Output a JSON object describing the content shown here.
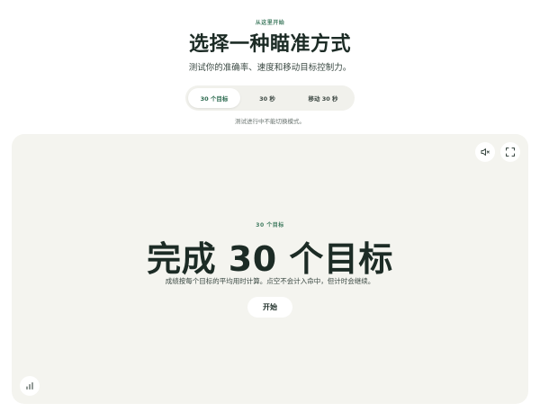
{
  "header": {
    "kicker": "从这里开始",
    "title": "选择一种瞄准方式",
    "subtitle": "测试你的准确率、速度和移动目标控制力。"
  },
  "mode_tabs": {
    "items": [
      {
        "label": "30 个目标",
        "selected": true
      },
      {
        "label": "30 秒",
        "selected": false
      },
      {
        "label": "移动 30 秒",
        "selected": false
      }
    ],
    "note": "测试进行中不能切换模式。"
  },
  "stage": {
    "kicker": "30 个目标",
    "title": "完成 30 个目标",
    "description": "成绩按每个目标的平均用时计算。点空不会计入命中，但计时会继续。",
    "start_label": "开始",
    "icons": {
      "sound": "speaker-muted-icon",
      "fullscreen": "fullscreen-icon",
      "stats": "bar-chart-icon"
    }
  },
  "colors": {
    "accent": "#3f7a5f",
    "title": "#1c2b25",
    "stage_bg": "#f4f4ef",
    "tabs_bg": "#f1f1ec"
  }
}
